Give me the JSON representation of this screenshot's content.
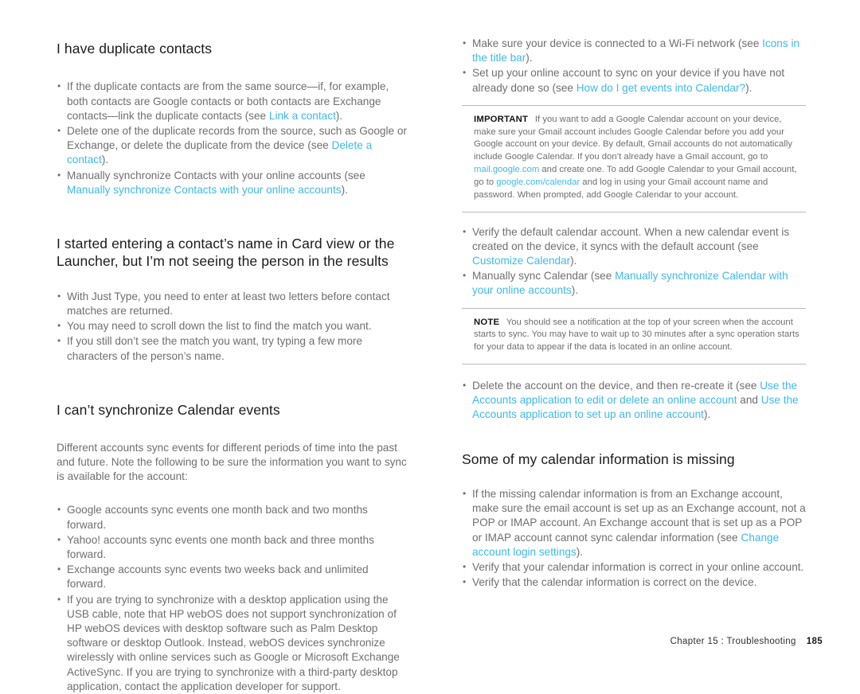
{
  "document": {
    "type": "user-guide-page",
    "chapter_footer": "Chapter 15 : Troubleshooting",
    "page_number": "185",
    "link_color": "#3fb9e8",
    "body_color": "#6f6f6f",
    "heading_color": "#1b1b1b"
  },
  "left_column": {
    "section1": {
      "heading": "I have duplicate contacts",
      "bullets": [
        {
          "parts": [
            {
              "text": "If the duplicate contacts are from the same source—if, for example, both contacts are Google contacts or both contacts are Exchange contacts—link the duplicate contacts (see ",
              "link": false
            },
            {
              "text": "Link a contact",
              "link": true
            },
            {
              "text": ").",
              "link": false
            }
          ]
        },
        {
          "parts": [
            {
              "text": "Delete one of the duplicate records from the source, such as Google or Exchange, or delete the duplicate from the device (see ",
              "link": false
            },
            {
              "text": "Delete a contact",
              "link": true
            },
            {
              "text": ").",
              "link": false
            }
          ]
        },
        {
          "parts": [
            {
              "text": "Manually synchronize Contacts with your online accounts (see ",
              "link": false
            },
            {
              "text": "Manually synchronize Contacts with your online accounts",
              "link": true
            },
            {
              "text": ").",
              "link": false
            }
          ]
        }
      ]
    },
    "section2": {
      "heading": "I started entering a contact’s name in Card view or the Launcher, but I’m not seeing the person in the results",
      "bullets": [
        {
          "parts": [
            {
              "text": "With Just Type, you need to enter at least two letters before contact matches are returned.",
              "link": false
            }
          ]
        },
        {
          "parts": [
            {
              "text": "You may need to scroll down the list to find the match you want.",
              "link": false
            }
          ]
        },
        {
          "parts": [
            {
              "text": "If you still don’t see the match you want, try typing a few more characters of the person’s name.",
              "link": false
            }
          ]
        }
      ]
    },
    "section3": {
      "heading": "I can’t synchronize Calendar events",
      "intro": "Different accounts sync events for different periods of time into the past and future. Note the following to be sure the information you want to sync is available for the account:",
      "bullets": [
        {
          "parts": [
            {
              "text": "Google accounts sync events one month back and two months forward.",
              "link": false
            }
          ]
        },
        {
          "parts": [
            {
              "text": "Yahoo! accounts sync events one month back and three months forward.",
              "link": false
            }
          ]
        },
        {
          "parts": [
            {
              "text": "Exchange accounts sync events two weeks back and unlimited forward.",
              "link": false
            }
          ]
        },
        {
          "parts": [
            {
              "text": "If you are trying to synchronize with a desktop application using the USB cable, note that HP webOS does not support synchronization of HP webOS devices with desktop software such as Palm Desktop software or desktop Outlook. Instead, webOS devices synchronize wirelessly with online services such as Google or Microsoft Exchange ActiveSync. If you are trying to synchronize with a third-party desktop application, contact the application developer for support.",
              "link": false
            }
          ]
        }
      ]
    }
  },
  "right_column": {
    "bullets_top": [
      {
        "parts": [
          {
            "text": "Make sure your device is connected to a Wi-Fi network (see ",
            "link": false
          },
          {
            "text": "Icons in the title bar",
            "link": true
          },
          {
            "text": ").",
            "link": false
          }
        ]
      },
      {
        "parts": [
          {
            "text": "Set up your online account to sync on your device if you have not already done so (see ",
            "link": false
          },
          {
            "text": "How do I get events into Calendar?",
            "link": true
          },
          {
            "text": ").",
            "link": false
          }
        ]
      }
    ],
    "important_note": {
      "label": "IMPORTANT",
      "parts": [
        {
          "text": "If you want to add a Google Calendar account on your device, make sure your Gmail account includes Google Calendar before you add your Google account on your device. By default, Gmail accounts do not automatically include Google Calendar. If you don’t already have a Gmail account, go to ",
          "link": false
        },
        {
          "text": "mail.google.com",
          "link": true
        },
        {
          "text": " and create one. To add Google Calendar to your Gmail account, go to ",
          "link": false
        },
        {
          "text": "google.com/calendar",
          "link": true
        },
        {
          "text": " and log in using your Gmail account name and password. When prompted, add Google Calendar to your account.",
          "link": false
        }
      ]
    },
    "bullets_middle": [
      {
        "parts": [
          {
            "text": "Verify the default calendar account. When a new calendar event is created on the device, it syncs with the default account (see ",
            "link": false
          },
          {
            "text": "Customize Calendar",
            "link": true
          },
          {
            "text": ").",
            "link": false
          }
        ]
      },
      {
        "parts": [
          {
            "text": "Manually sync Calendar (see ",
            "link": false
          },
          {
            "text": "Manually synchronize Calendar with your online accounts",
            "link": true
          },
          {
            "text": ").",
            "link": false
          }
        ]
      }
    ],
    "plain_note": {
      "label": "NOTE",
      "parts": [
        {
          "text": "You should see a notification at the top of your screen when the account starts to sync. You may have to wait up to 30 minutes after a sync operation starts for your data to appear if the data is located in an online account.",
          "link": false
        }
      ]
    },
    "bullets_after_note": [
      {
        "parts": [
          {
            "text": "Delete the account on the device, and then re-create it (see ",
            "link": false
          },
          {
            "text": "Use the Accounts application to edit or delete an online account",
            "link": true
          },
          {
            "text": " and ",
            "link": false
          },
          {
            "text": "Use the Accounts application to set up an online account",
            "link": true
          },
          {
            "text": ").",
            "link": false
          }
        ]
      }
    ],
    "section_missing": {
      "heading": "Some of my calendar information is missing",
      "bullets": [
        {
          "parts": [
            {
              "text": "If the missing calendar information is from an Exchange account, make sure the email account is set up as an Exchange account, not a POP or IMAP account. An Exchange account that is set up as a POP or IMAP account cannot sync calendar information (see ",
              "link": false
            },
            {
              "text": "Change account login settings",
              "link": true
            },
            {
              "text": ").",
              "link": false
            }
          ]
        },
        {
          "parts": [
            {
              "text": "Verify that your calendar information is correct in your online account.",
              "link": false
            }
          ]
        },
        {
          "parts": [
            {
              "text": "Verify that the calendar information is correct on the device.",
              "link": false
            }
          ]
        }
      ]
    }
  }
}
